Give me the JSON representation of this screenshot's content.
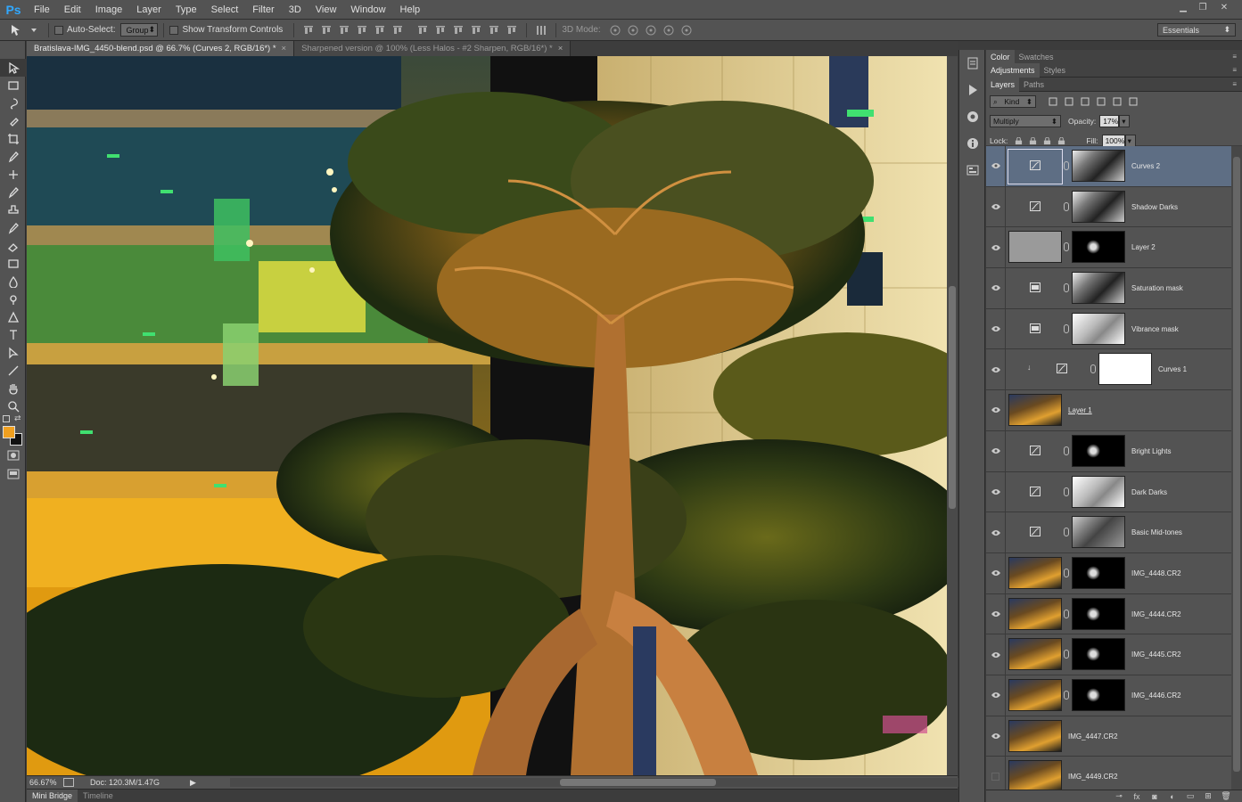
{
  "app": {
    "logo": "Ps",
    "menu": [
      "File",
      "Edit",
      "Image",
      "Layer",
      "Type",
      "Select",
      "Filter",
      "3D",
      "View",
      "Window",
      "Help"
    ],
    "window_controls": [
      "minimize-icon",
      "restore-icon",
      "close-icon"
    ]
  },
  "options": {
    "auto_select_label": "Auto-Select:",
    "auto_select_value": "Group",
    "show_transform_label": "Show Transform Controls",
    "mode_3d_label": "3D Mode:",
    "workspace": "Essentials"
  },
  "doc_tabs": [
    {
      "label": "Bratislava-IMG_4450-blend.psd @ 66.7% (Curves 2, RGB/16*) *",
      "close": "×",
      "active": true
    },
    {
      "label": "Sharpened version @ 100% (Less Halos - #2 Sharpen, RGB/16*) *",
      "close": "×",
      "active": false
    }
  ],
  "status": {
    "zoom": "66.67%",
    "doc_size": "Doc: 120.3M/1.47G"
  },
  "bottom_tabs": [
    "Mini Bridge",
    "Timeline"
  ],
  "panels": {
    "top_tabs": [
      "Color",
      "Swatches"
    ],
    "mid_tabs": [
      "Adjustments",
      "Styles"
    ],
    "layer_tabs": [
      "Layers",
      "Paths"
    ],
    "filter_kind": "Kind",
    "blend_mode": "Multiply",
    "opacity_label": "Opacity:",
    "opacity_value": "17%",
    "lock_label": "Lock:",
    "fill_label": "Fill:",
    "fill_value": "100%"
  },
  "layers": [
    {
      "name": "Curves 2",
      "kind": "curves",
      "visible": true,
      "selected": true,
      "mask": "dark-mask"
    },
    {
      "name": "Shadow Darks",
      "kind": "curves",
      "visible": true,
      "selected": false,
      "mask": "dark-mask"
    },
    {
      "name": "Layer 2",
      "kind": "pixel",
      "visible": true,
      "selected": false,
      "mask": "black-mask"
    },
    {
      "name": "Saturation mask",
      "kind": "hue",
      "visible": true,
      "selected": false,
      "mask": "dark-mask"
    },
    {
      "name": "Vibrance mask",
      "kind": "hue",
      "visible": true,
      "selected": false,
      "mask": "light-mask"
    },
    {
      "name": "Curves 1",
      "kind": "curves-clipped",
      "visible": true,
      "selected": false,
      "mask": "white-mask"
    },
    {
      "name": "Layer 1",
      "kind": "image",
      "visible": true,
      "selected": false,
      "mask": "none"
    },
    {
      "name": "Bright Lights",
      "kind": "curves",
      "visible": true,
      "selected": false,
      "mask": "black-mask"
    },
    {
      "name": "Dark Darks",
      "kind": "curves",
      "visible": true,
      "selected": false,
      "mask": "light-mask"
    },
    {
      "name": "Basic Mid-tones",
      "kind": "curves",
      "visible": true,
      "selected": false,
      "mask": "mid-mask"
    },
    {
      "name": "IMG_4448.CR2",
      "kind": "image-masked",
      "visible": true,
      "selected": false,
      "mask": "black-mask"
    },
    {
      "name": "IMG_4444.CR2",
      "kind": "image-masked",
      "visible": true,
      "selected": false,
      "mask": "black-mask"
    },
    {
      "name": "IMG_4445.CR2",
      "kind": "image-masked",
      "visible": true,
      "selected": false,
      "mask": "black-mask"
    },
    {
      "name": "IMG_4446.CR2",
      "kind": "image-masked",
      "visible": true,
      "selected": false,
      "mask": "black-mask"
    },
    {
      "name": "IMG_4447.CR2",
      "kind": "image",
      "visible": true,
      "selected": false,
      "mask": "none"
    },
    {
      "name": "IMG_4449.CR2",
      "kind": "image",
      "visible": false,
      "selected": false,
      "mask": "none"
    }
  ]
}
